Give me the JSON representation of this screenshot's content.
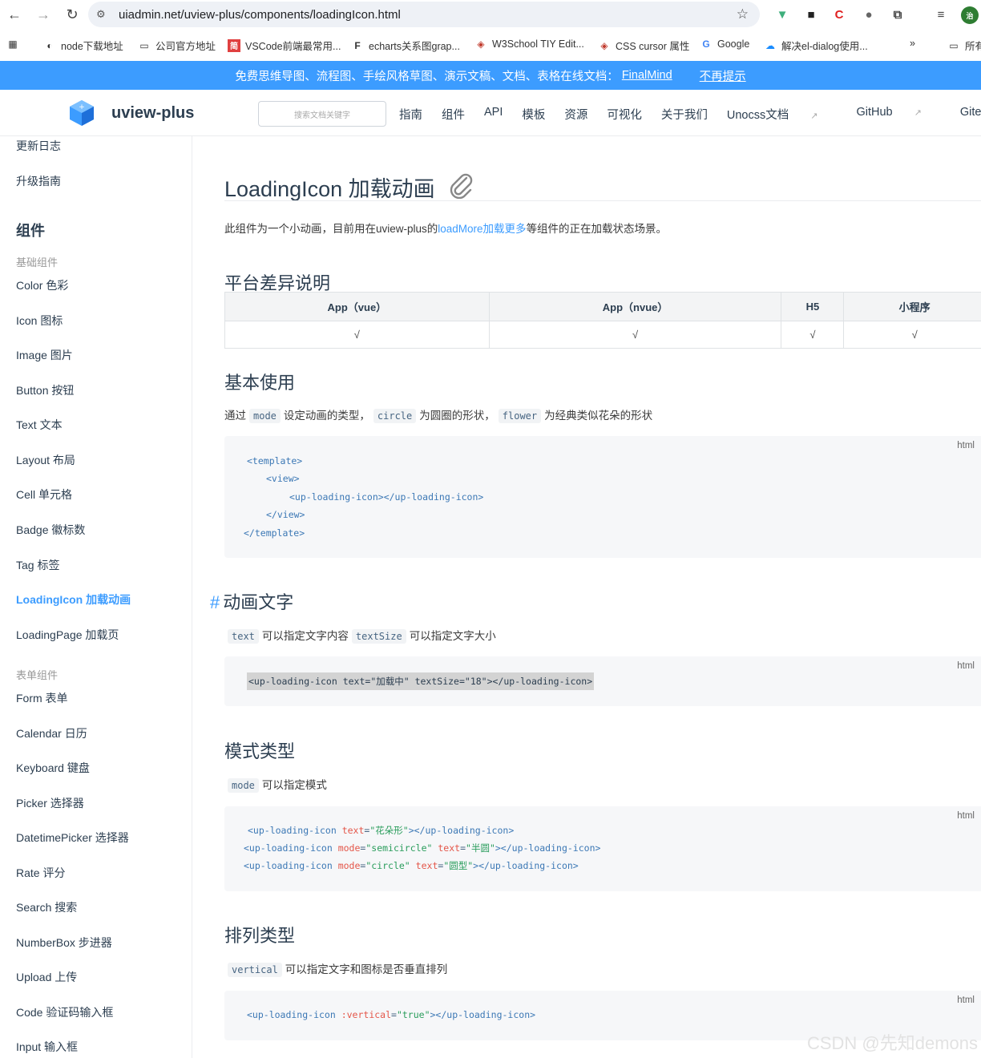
{
  "browser": {
    "url": "uiadmin.net/uview-plus/components/loadingIcon.html",
    "bookmarks": [
      "node下载地址",
      "公司官方地址",
      "VSCode前端最常用...",
      "echarts关系图grap...",
      "W3School TIY Edit...",
      "CSS cursor 属性",
      "Google",
      "解决el-dialog使用...",
      "所有"
    ],
    "more": "»"
  },
  "notice": {
    "text": "免费思维导图、流程图、手绘风格草图、演示文稿、文档、表格在线文档：",
    "link": "FinalMind",
    "dismiss": "不再提示"
  },
  "header": {
    "brand": "uview-plus",
    "search_placeholder": "搜索文档关键字",
    "nav": [
      "指南",
      "组件",
      "API",
      "模板",
      "资源",
      "可视化",
      "关于我们",
      "Unocss文档",
      "GitHub",
      "Gitee"
    ]
  },
  "sidebar": {
    "top_items": [
      "更新日志",
      "升级指南"
    ],
    "section": "组件",
    "group_basic": "基础组件",
    "basic_items": [
      "Color 色彩",
      "Icon 图标",
      "Image 图片",
      "Button 按钮",
      "Text 文本",
      "Layout 布局",
      "Cell 单元格",
      "Badge 徽标数",
      "Tag 标签",
      "LoadingIcon 加载动画",
      "LoadingPage 加载页"
    ],
    "group_form": "表单组件",
    "form_items": [
      "Form 表单",
      "Calendar 日历",
      "Keyboard 键盘",
      "Picker 选择器",
      "DatetimePicker 选择器",
      "Rate 评分",
      "Search 搜索",
      "NumberBox 步进器",
      "Upload 上传",
      "Code 验证码输入框",
      "Input 输入框"
    ]
  },
  "content": {
    "title": "LoadingIcon 加载动画",
    "intro_pre": "此组件为一个小动画，目前用在uview-plus的",
    "intro_link": "loadMore加载更多",
    "intro_post": "等组件的正在加载状态场景。",
    "platform": {
      "heading": "平台差异说明",
      "headers": [
        "App（vue）",
        "App（nvue）",
        "H5",
        "小程序"
      ],
      "values": [
        "√",
        "√",
        "√",
        "√"
      ]
    },
    "basic": {
      "heading": "基本使用",
      "t1": "通过",
      "c1": "mode",
      "t2": "设定动画的类型，",
      "c2": "circle",
      "t3": "为圆圈的形状，",
      "c3": "flower",
      "t4": "为经典类似花朵的形状",
      "lang": "html",
      "lines": [
        "<template>",
        "<view>",
        "<up-loading-icon></up-loading-icon>",
        "</view>",
        "</template>"
      ]
    },
    "text_sec": {
      "heading": "动画文字",
      "hash": "#",
      "c1": "text",
      "t1": "可以指定文字内容",
      "c2": "textSize",
      "t2": "可以指定文字大小",
      "lang": "html",
      "code": "<up-loading-icon text=\"加载中\" textSize=\"18\"></up-loading-icon>"
    },
    "mode_sec": {
      "heading": "模式类型",
      "c1": "mode",
      "t1": "可以指定模式",
      "lang": "html",
      "l1_tag": "<up-loading-icon ",
      "l1_attr": "text",
      "l1_val": "\"花朵形\"",
      "l1_end": "></up-loading-icon>",
      "l2_tag": "<up-loading-icon ",
      "l2_attr1": "mode",
      "l2_val1": "\"semicircle\"",
      "l2_attr2": "text",
      "l2_val2": "\"半圆\"",
      "l2_end": "></up-loading-icon>",
      "l3_tag": "<up-loading-icon ",
      "l3_attr1": "mode",
      "l3_val1": "\"circle\"",
      "l3_attr2": "text",
      "l3_val2": "\"圆型\"",
      "l3_end": "></up-loading-icon>"
    },
    "arrange_sec": {
      "heading": "排列类型",
      "c1": "vertical",
      "t1": "可以指定文字和图标是否垂直排列",
      "lang": "html",
      "tag": "<up-loading-icon ",
      "attr": ":vertical",
      "val": "\"true\"",
      "end": "></up-loading-icon>"
    }
  },
  "watermark": "CSDN @先知demons",
  "colors": {
    "accent": "#3c9cff",
    "notice_bg": "#3c9cff"
  }
}
